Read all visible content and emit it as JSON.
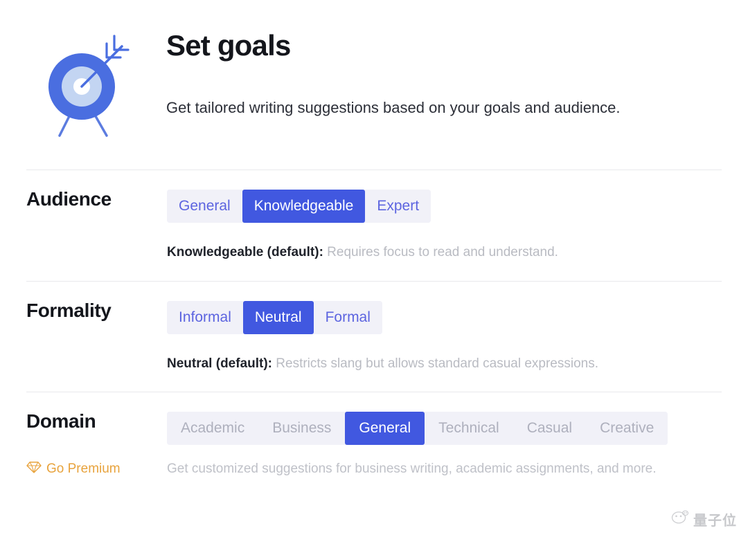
{
  "header": {
    "icon": "target-with-arrow-icon",
    "title": "Set goals",
    "subtitle": "Get tailored writing suggestions based on your goals and audience."
  },
  "sections": [
    {
      "id": "audience",
      "label": "Audience",
      "options": [
        "General",
        "Knowledgeable",
        "Expert"
      ],
      "selected": "Knowledgeable",
      "disabled": false,
      "description_strong": "Knowledgeable (default):",
      "description_rest": " Requires focus to read and understand."
    },
    {
      "id": "formality",
      "label": "Formality",
      "options": [
        "Informal",
        "Neutral",
        "Formal"
      ],
      "selected": "Neutral",
      "disabled": false,
      "description_strong": "Neutral (default):",
      "description_rest": " Restricts slang but allows standard casual expressions."
    },
    {
      "id": "domain",
      "label": "Domain",
      "options": [
        "Academic",
        "Business",
        "General",
        "Technical",
        "Casual",
        "Creative"
      ],
      "selected": "General",
      "disabled": true,
      "description_strong": "",
      "description_rest": ""
    }
  ],
  "premium": {
    "icon": "diamond-icon",
    "link_label": "Go Premium",
    "description": "Get customized suggestions for business writing, academic assignments, and more.",
    "accent_color": "#e8a33d"
  },
  "watermark": {
    "icon": "wechat-cat-logo",
    "text": "量子位"
  },
  "colors": {
    "accent_blue": "#4158e0",
    "option_text_blue": "#5c64e0",
    "option_bg": "#f1f1f8",
    "disabled_text": "#aeb0bd",
    "muted_text": "#b9bbc2",
    "title": "#14161c"
  }
}
